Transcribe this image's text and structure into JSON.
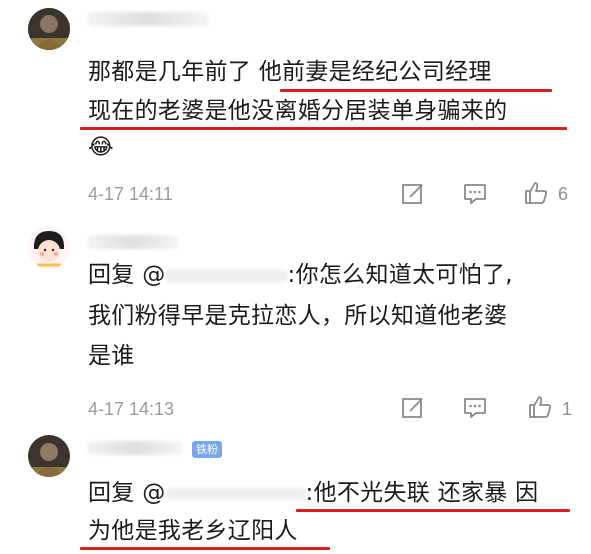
{
  "comments": [
    {
      "text_line1_a": "那都是几年前了 ",
      "text_line1_b": "他前妻是经纪公司经理",
      "text_line2": "现在的老婆是他没离婚分居装单身骗来的",
      "emoji": "😂",
      "time": "4-17 14:11",
      "like_count": "6"
    },
    {
      "reply_prefix": "回复 @",
      "reply_rest": ":你怎么知道太可怕了,",
      "line2": "我们粉得早是克拉恋人，所以知道他老婆",
      "line3": "是谁",
      "time": "4-17 14:13",
      "like_count": "1"
    },
    {
      "badge": "铁粉",
      "reply_prefix": "回复 @",
      "reply_rest": ":他不光失联 还家暴 因",
      "line2": "为他是我老乡辽阳人"
    }
  ],
  "icons": {
    "edit": "edit-icon",
    "reply": "comment-icon",
    "like": "thumbs-up-icon"
  },
  "colors": {
    "underline": "#d81e1e",
    "meta_text": "#9b9b9b",
    "badge": "#79a6e6"
  }
}
